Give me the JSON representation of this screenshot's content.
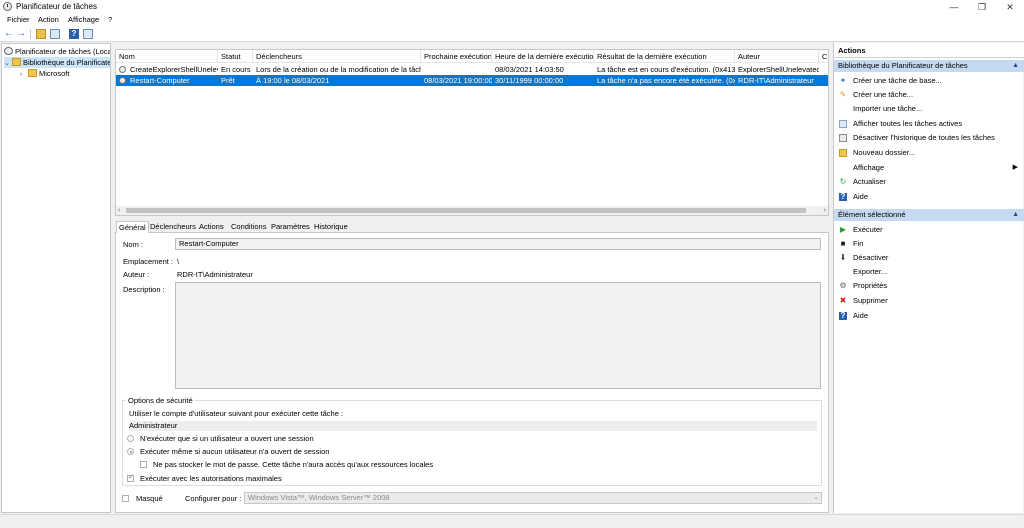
{
  "window": {
    "title": "Planificateur de tâches",
    "minimize": "—",
    "restore": "❐",
    "close": "✕"
  },
  "menu": {
    "items": [
      "Fichier",
      "Action",
      "Affichage",
      "?"
    ]
  },
  "toolbar": {
    "help": "?"
  },
  "tree": {
    "root": "Planificateur de tâches (Local)",
    "library": "Bibliothèque du Planificateur de tâches",
    "child": "Microsoft",
    "expand_glyph": "⌄",
    "collapse_glyph": "›"
  },
  "task_list": {
    "columns": [
      "Nom",
      "Statut",
      "Déclencheurs",
      "Prochaine exécution",
      "Heure de la dernière exécution",
      "Résultat de la dernière exécution",
      "Auteur",
      "C"
    ],
    "rows": [
      [
        "CreateExplorerShellUnelevatedTask",
        "En cours",
        "Lors de la création ou de la modification de la tâche",
        "",
        "08/03/2021 14:03:50",
        "La tâche est en cours d'exécution. (0x41301)",
        "ExplorerShellUnelevated",
        ""
      ],
      [
        "Restart-Computer",
        "Prêt",
        "À 19:00 le 08/03/2021",
        "08/03/2021 19:00:00",
        "30/11/1999 00:00:00",
        "La tâche n'a pas encore été exécutée. (0x41303)",
        "RDR-IT\\Administrateur",
        ""
      ]
    ],
    "selected_row": 1,
    "scroll_left": "‹",
    "scroll_right": "›"
  },
  "details": {
    "tabs": [
      "Général",
      "Déclencheurs",
      "Actions",
      "Conditions",
      "Paramètres",
      "Historique"
    ],
    "active_tab": 0,
    "name_label": "Nom :",
    "name_value": "Restart-Computer",
    "location_label": "Emplacement :",
    "location_value": "\\",
    "author_label": "Auteur :",
    "author_value": "RDR-IT\\Administrateur",
    "description_label": "Description :",
    "security": {
      "title": "Options de sécurité",
      "account_prompt": "Utiliser le compte d'utilisateur suivant pour exécuter cette tâche :",
      "account": "Administrateur",
      "opt_logged_on": "N'exécuter que si un utilisateur a ouvert une session",
      "opt_whether": "Exécuter même si aucun utilisateur n'a ouvert de session",
      "opt_no_password": "Ne pas stocker le mot de passe. Cette tâche n'aura accès qu'aux ressources locales",
      "opt_highest": "Exécuter avec les autorisations maximales"
    },
    "hidden_label": "Masqué",
    "configure_label": "Configurer pour :",
    "configure_value": "Windows Vista™, Windows Server™ 2008",
    "dropdown_glyph": "⌄"
  },
  "actions": {
    "title": "Actions",
    "section1": "Bibliothèque du Planificateur de tâches",
    "section1_items": [
      "Créer une tâche de base...",
      "Créer une tâche...",
      "Importer une tâche...",
      "Afficher toutes les tâches actives",
      "Désactiver l'historique de toutes les tâches",
      "Nouveau dossier...",
      "Affichage",
      "Actualiser",
      "Aide"
    ],
    "section2": "Élément sélectionné",
    "section2_items": [
      "Exécuter",
      "Fin",
      "Désactiver",
      "Exporter...",
      "Propriétés",
      "Supprimer",
      "Aide"
    ],
    "collapse_glyph": "▲",
    "submenu_glyph": "▶",
    "glyphs": {
      "run": "▶",
      "end": "■",
      "disable": "⬇",
      "delete": "✖",
      "help": "?",
      "refresh": "↻",
      "properties": "⚙"
    },
    "colors": {
      "section_bg": "#c5daf0",
      "run": "#2e9e3a",
      "delete": "#d32020",
      "help": "#2a5fb0"
    }
  },
  "colors": {
    "selection": "#0078d7"
  }
}
